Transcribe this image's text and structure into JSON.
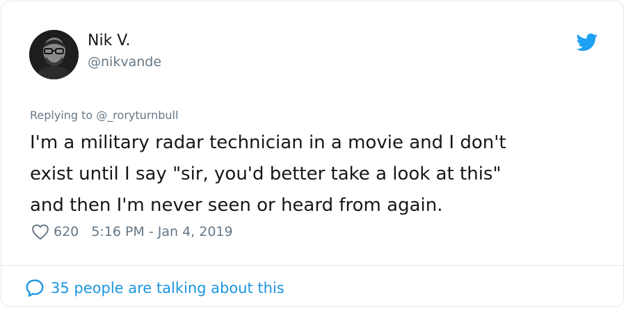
{
  "author": {
    "display_name": "Nik V.",
    "handle": "@nikvande",
    "avatar_icon": "avatar-photo"
  },
  "brand": {
    "icon": "twitter-bird-icon",
    "color": "#1da1f2"
  },
  "reply": {
    "prefix": "Replying to ",
    "mention": "@_roryturnbull"
  },
  "tweet": {
    "text": "I'm a military radar technician in a movie and I don't\nexist until I say \"sir, you'd better take a look at this\"\nand then I'm never seen or heard from again."
  },
  "meta": {
    "like_icon": "heart-icon",
    "likes": "620",
    "timestamp": "5:16 PM - Jan 4, 2019"
  },
  "conversation": {
    "icon": "speech-bubble-icon",
    "label": "35 people are talking about this",
    "color": "#1b95e0"
  },
  "colors": {
    "text": "#14171a",
    "secondary": "#657786",
    "border": "#e1e8ed"
  }
}
